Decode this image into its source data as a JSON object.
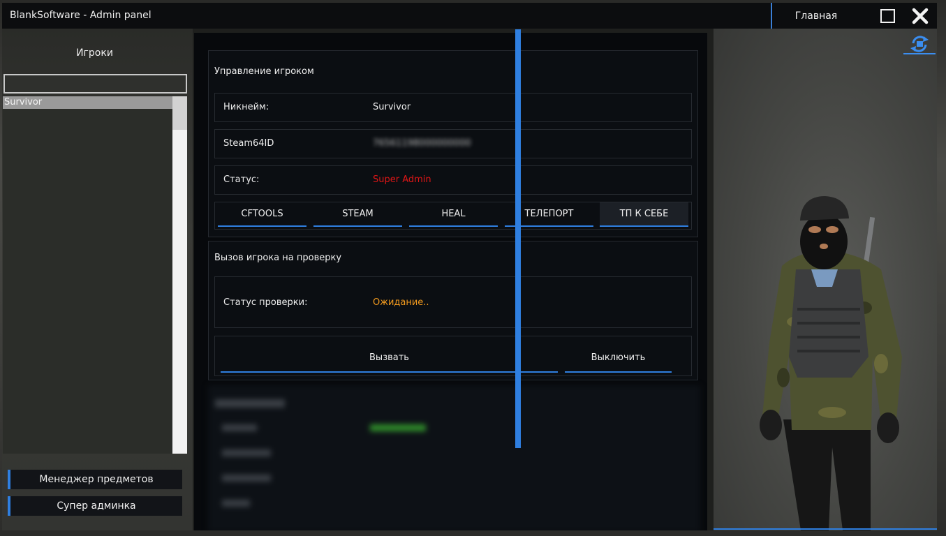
{
  "window": {
    "title": "BlankSoftware - Admin panel",
    "home_label": "Главная"
  },
  "sidebar": {
    "title": "Игроки",
    "search_value": "",
    "players": [
      "Survivor"
    ],
    "buttons": [
      "Менеджер предметов",
      "Супер админка"
    ]
  },
  "player_card": {
    "title": "Управление игроком",
    "nickname_label": "Никнейм:",
    "nickname_value": "Survivor",
    "steam_label": "Steam64ID",
    "steam_value": "76561198000000000",
    "status_label": "Статус:",
    "status_value": "Super Admin",
    "actions": [
      "CFTOOLS",
      "STEAM",
      "HEAL",
      "ТЕЛЕПОРТ",
      "ТП К СЕБЕ"
    ]
  },
  "check_card": {
    "title": "Вызов игрока на проверку",
    "status_label": "Статус проверки:",
    "status_value": "Ожидание..",
    "call_button": "Вызвать",
    "off_button": "Выключить"
  },
  "colors": {
    "accent": "#2f7fe0",
    "status_admin": "#e01616",
    "status_waiting": "#f29a1e",
    "panel_dark": "#07090c"
  },
  "icons": {
    "maximize": "maximize-icon",
    "close": "close-icon",
    "rotate": "rotate-camera-icon"
  }
}
